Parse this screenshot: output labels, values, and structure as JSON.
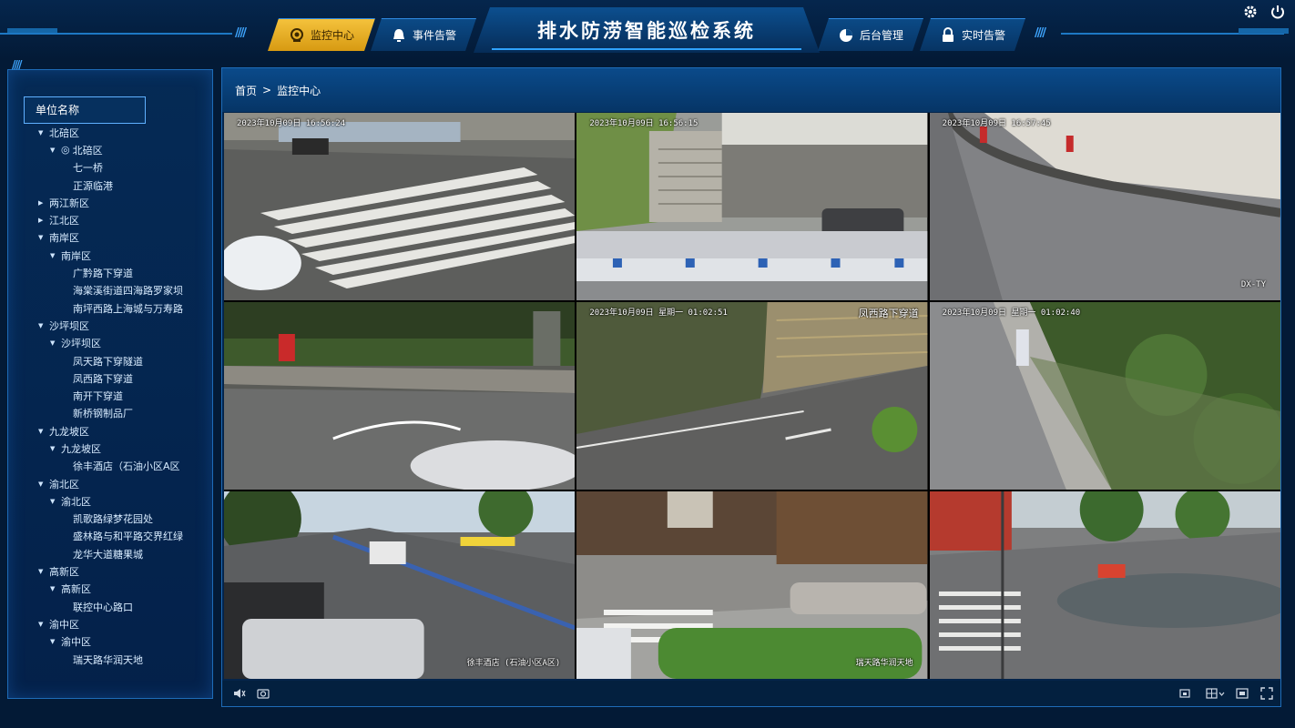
{
  "header": {
    "system_title": "排水防涝智能巡检系统",
    "nav_left": [
      {
        "label": "监控中心",
        "icon": "camera-icon",
        "active": true
      },
      {
        "label": "事件告警",
        "icon": "bell-icon",
        "active": false
      }
    ],
    "nav_right": [
      {
        "label": "后台管理",
        "icon": "pie-chart-icon",
        "active": false
      },
      {
        "label": "实时告警",
        "icon": "lock-alarm-icon",
        "active": false
      }
    ],
    "top_icons": [
      "settings-icon",
      "power-icon"
    ]
  },
  "tree": {
    "placeholder": "单位名称",
    "nodes": [
      {
        "label": "北碚区",
        "level": 0,
        "arrow": "down"
      },
      {
        "label": "北碚区",
        "level": 1,
        "arrow": "down",
        "pin": true
      },
      {
        "label": "七一桥",
        "level": 2
      },
      {
        "label": "正源临港",
        "level": 2
      },
      {
        "label": "两江新区",
        "level": 0,
        "arrow": "right"
      },
      {
        "label": "江北区",
        "level": 0,
        "arrow": "right"
      },
      {
        "label": "南岸区",
        "level": 0,
        "arrow": "down"
      },
      {
        "label": "南岸区",
        "level": 1,
        "arrow": "down"
      },
      {
        "label": "广黔路下穿道",
        "level": 2
      },
      {
        "label": "海棠溪街道四海路罗家坝",
        "level": 2
      },
      {
        "label": "南坪西路上海城与万寿路",
        "level": 2
      },
      {
        "label": "沙坪坝区",
        "level": 0,
        "arrow": "down"
      },
      {
        "label": "沙坪坝区",
        "level": 1,
        "arrow": "down"
      },
      {
        "label": "凤天路下穿隧道",
        "level": 2
      },
      {
        "label": "凤西路下穿道",
        "level": 2
      },
      {
        "label": "南开下穿道",
        "level": 2
      },
      {
        "label": "新桥钢制品厂",
        "level": 2
      },
      {
        "label": "九龙坡区",
        "level": 0,
        "arrow": "down"
      },
      {
        "label": "九龙坡区",
        "level": 1,
        "arrow": "down"
      },
      {
        "label": "徐丰酒店（石油小区A区",
        "level": 2
      },
      {
        "label": "渝北区",
        "level": 0,
        "arrow": "down"
      },
      {
        "label": "渝北区",
        "level": 1,
        "arrow": "down"
      },
      {
        "label": "凯歌路绿梦花园处",
        "level": 2
      },
      {
        "label": "盛林路与和平路交界红绿",
        "level": 2
      },
      {
        "label": "龙华大道糖果城",
        "level": 2
      },
      {
        "label": "高新区",
        "level": 0,
        "arrow": "down"
      },
      {
        "label": "高新区",
        "level": 1,
        "arrow": "down"
      },
      {
        "label": "联控中心路口",
        "level": 2
      },
      {
        "label": "渝中区",
        "level": 0,
        "arrow": "down"
      },
      {
        "label": "渝中区",
        "level": 1,
        "arrow": "down"
      },
      {
        "label": "瑞天路华润天地",
        "level": 2
      }
    ]
  },
  "breadcrumb": {
    "home": "首页",
    "separator": ">",
    "current": "监控中心"
  },
  "cameras": [
    {
      "time": "2023年10月09日 16:56:24",
      "loc": "",
      "br": ""
    },
    {
      "time": "2023年10月09日 16:56:15",
      "loc": "",
      "br": ""
    },
    {
      "time": "2023年10月09日 16:57:45",
      "loc": "",
      "br": "DX-TY"
    },
    {
      "time": "",
      "loc": "",
      "br": ""
    },
    {
      "time": "2023年10月09日 星期一 01:02:51",
      "loc": "凤西路下穿道",
      "br": ""
    },
    {
      "time": "2023年10月09日 星期一 01:02:40",
      "loc": "",
      "br": ""
    },
    {
      "time": "",
      "loc": "",
      "br": "徐丰酒店 (石油小区A区)"
    },
    {
      "time": "",
      "loc": "",
      "br": "瑞天路华润天地"
    },
    {
      "time": "",
      "loc": "",
      "br": ""
    }
  ],
  "toolbar": {
    "left_icons": [
      "volume-icon",
      "snapshot-icon"
    ],
    "right_icons": [
      "record-icon",
      "layout-grid-icon",
      "single-view-icon",
      "fullscreen-icon"
    ]
  },
  "colors": {
    "background": "#031a36",
    "panel_border": "#1e6cb8",
    "active_nav": "#f4c23c",
    "selected_camera": "#f1cc3f"
  }
}
